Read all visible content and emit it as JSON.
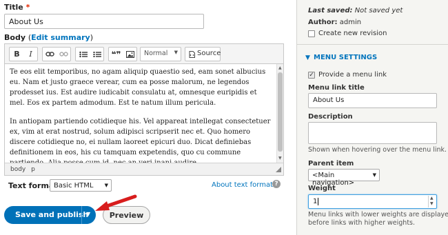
{
  "title_field": {
    "label": "Title",
    "required_mark": "*",
    "value": "About Us"
  },
  "body_field": {
    "label": "Body",
    "edit_summary_open": "(",
    "edit_summary_link": "Edit summary",
    "edit_summary_close": ")"
  },
  "toolbar": {
    "bold": "B",
    "italic": "I",
    "blockquote": "❝❞",
    "format_select": "Normal",
    "source_label": "Source"
  },
  "editor": {
    "paragraphs": [
      "Te eos elit temporibus, no agam aliquip quaestio sed, eam sonet albucius eu. Nam et justo graece verear, cum ea posse malorum, ne legendos prodesset ius. Est audire iudicabit consulatu at, omnesque euripidis et mel. Eos ex partem admodum. Est te natum illum pericula.",
      "In antiopam partiendo cotidieque his. Vel appareat intellegat consectetuer ex, vim at erat nostrud, solum adipisci scripserit nec et. Quo homero discere cotidieque no, ei nullam laoreet epicuri duo. Dicat definiebas definitionem in eos, his cu tamquam expetendis, quo cu commune partiendo. Alia posse cum id, nec an veri inani audire."
    ],
    "path": [
      "body",
      "p"
    ]
  },
  "text_format": {
    "label": "Text format",
    "value": "Basic HTML",
    "about_link": "About text formats"
  },
  "actions": {
    "save_publish": "Save and publish",
    "preview": "Preview"
  },
  "sidebar": {
    "last_saved_label": "Last saved:",
    "last_saved_value": "Not saved yet",
    "author_label": "Author:",
    "author_value": "admin",
    "create_revision_label": "Create new revision",
    "create_revision_checked": false,
    "menu_settings": {
      "header": "MENU SETTINGS",
      "provide_link_label": "Provide a menu link",
      "provide_link_checked": true,
      "link_title_label": "Menu link title",
      "link_title_value": "About Us",
      "description_label": "Description",
      "description_value": "",
      "description_help": "Shown when hovering over the menu link.",
      "parent_label": "Parent item",
      "parent_value": "<Main navigation>",
      "weight_label": "Weight",
      "weight_value": "1",
      "weight_help_line1": "Menu links with lower weights are displayed",
      "weight_help_line2": "before links with higher weights."
    }
  },
  "colors": {
    "accent": "#0074bd",
    "primary_button": "#0071b8",
    "annotation_arrow": "#d81d1d",
    "required": "#e32700"
  }
}
